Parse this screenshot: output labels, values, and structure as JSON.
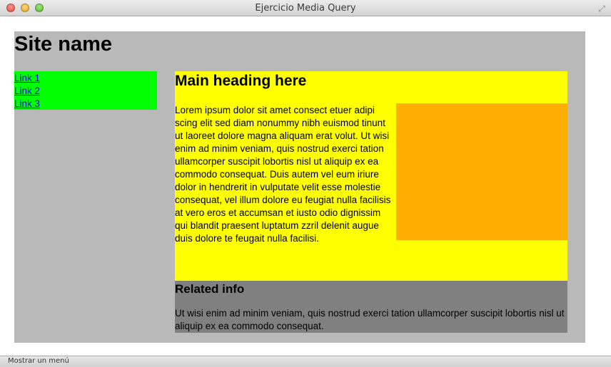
{
  "window": {
    "title": "Ejercicio Media Query",
    "close_icon": "close-icon",
    "minimize_icon": "minimize-icon",
    "zoom_icon": "zoom-icon",
    "fullscreen_icon": "fullscreen-icon"
  },
  "page": {
    "site_name": "Site name",
    "nav": {
      "links": [
        "Link 1",
        "Link 2",
        "Link 3"
      ]
    },
    "main": {
      "heading": "Main heading here",
      "body": "Lorem ipsum dolor sit amet consect etuer adipi scing elit sed diam nonummy nibh euismod tinunt ut laoreet dolore magna aliquam erat volut. Ut wisi enim ad minim veniam, quis nostrud exerci tation ullamcorper suscipit lobortis nisl ut aliquip ex ea commodo consequat. Duis autem vel eum iriure dolor in hendrerit in vulputate velit esse molestie consequat, vel illum dolore eu feugiat nulla facilisis at vero eros et accumsan et iusto odio dignissim qui blandit praesent luptatum zzril delenit augue duis dolore te feugait nulla facilisi."
    },
    "related": {
      "heading": "Related info",
      "body": "Ut wisi enim ad minim veniam, quis nostrud exerci tation ullamcorper suscipit lobortis nisl ut aliquip ex ea commodo consequat."
    }
  },
  "statusbar": {
    "text": "Mostrar un menú"
  },
  "colors": {
    "page_bg": "#b9b9b9",
    "nav_bg": "#00ff00",
    "main_bg": "#ffff00",
    "orange_box": "#ffad00",
    "related_bg": "#808080",
    "link": "#0000ee"
  }
}
